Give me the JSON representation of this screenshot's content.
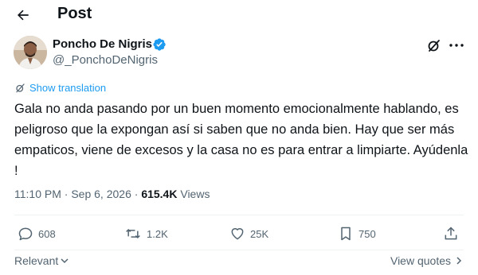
{
  "header": {
    "back_icon": "arrow-left-icon",
    "title": "Post"
  },
  "author": {
    "name": "Poncho De Nigris",
    "handle": "@_PonchoDeNigris",
    "verified": true,
    "verified_color": "#1d9bf0"
  },
  "translation": {
    "label": "Show translation",
    "icon": "translate-icon",
    "color": "#1d9bf0"
  },
  "post": {
    "text": "Gala no anda pasando por un buen momento emocionalmente hablando, es peligroso que la expongan así si saben que no anda bien. Hay que ser más empaticos, viene de excesos y la casa no es para entrar a limpiarte. Ayúdenla !"
  },
  "meta": {
    "time": "11:10 PM",
    "separator": "·",
    "date": "Sep 6, 2026",
    "views_count": "615.4K",
    "views_label": "Views"
  },
  "actions": {
    "replies": "608",
    "reposts": "1.2K",
    "likes": "25K",
    "bookmarks": "750"
  },
  "footer": {
    "sort_label": "Relevant",
    "view_quotes_label": "View quotes"
  },
  "colors": {
    "text": "#0f1419",
    "secondary": "#536471",
    "accent": "#1d9bf0",
    "divider": "#eff3f4"
  }
}
